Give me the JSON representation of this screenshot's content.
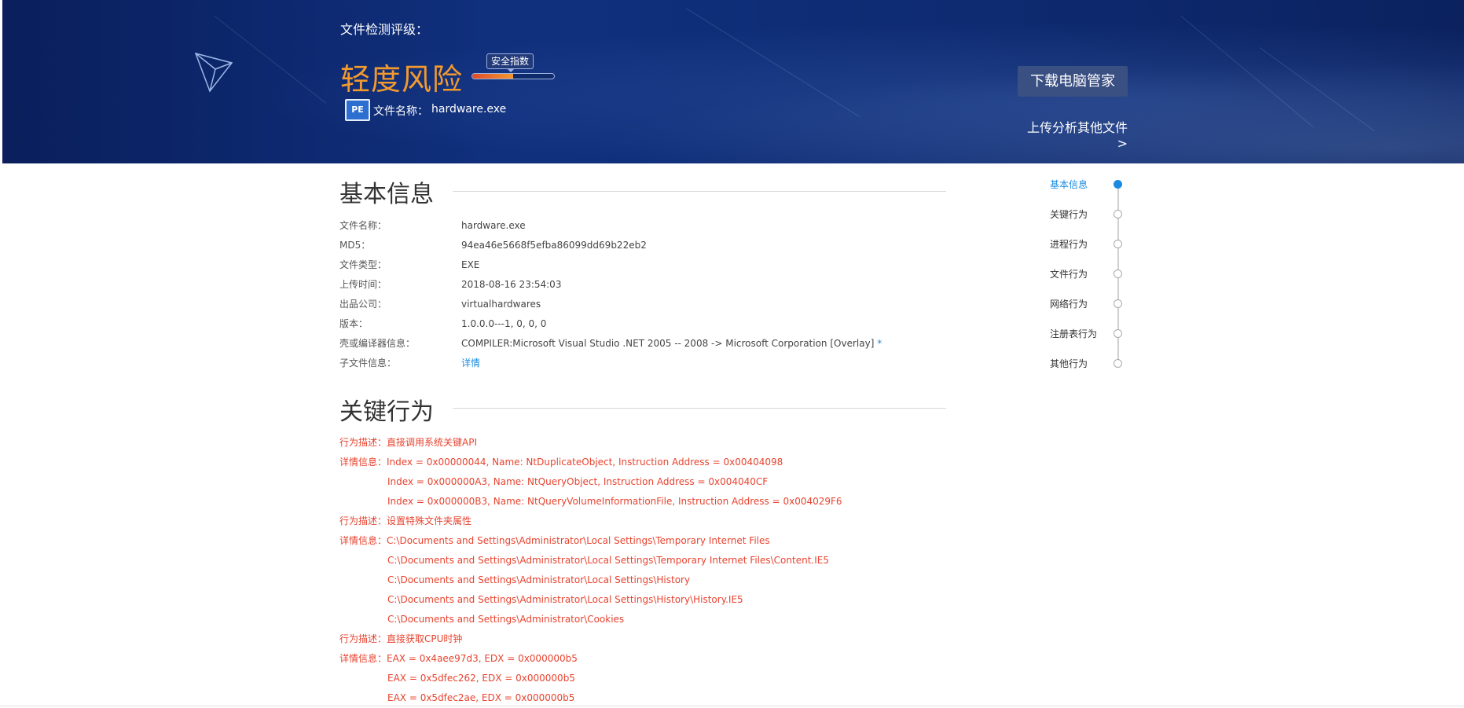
{
  "header": {
    "grade_label": "文件检测评级：",
    "risk_level": "轻度风险",
    "safety_index_label": "安全指数",
    "safety_index_level": 0.5,
    "file_icon_text": "PE",
    "file_name_label": "文件名称：",
    "file_name_value": "hardware.exe",
    "download_button": "下载电脑管家",
    "upload_link": "上传分析其他文件>"
  },
  "basic_info": {
    "title": "基本信息",
    "rows": [
      {
        "label": "文件名称：",
        "value": "hardware.exe"
      },
      {
        "label": "MD5：",
        "value": "94ea46e5668f5efba86099dd69b22eb2"
      },
      {
        "label": "文件类型：",
        "value": "EXE"
      },
      {
        "label": "上传时间：",
        "value": "2018-08-16 23:54:03"
      },
      {
        "label": "出品公司：",
        "value": "virtualhardwares"
      },
      {
        "label": "版本：",
        "value": "1.0.0.0---1, 0, 0, 0"
      },
      {
        "label": "壳或编译器信息：",
        "value": "COMPILER:Microsoft Visual Studio .NET 2005 -- 2008 -> Microsoft Corporation [Overlay]",
        "suffix": " *"
      },
      {
        "label": "子文件信息：",
        "value": "详情"
      }
    ]
  },
  "key_behavior": {
    "title": "关键行为",
    "lines": [
      "行为描述：直接调用系统关键API",
      "详情信息：Index = 0x00000044, Name: NtDuplicateObject, Instruction Address = 0x00404098",
      "Index = 0x000000A3, Name: NtQueryObject, Instruction Address = 0x004040CF",
      "Index = 0x000000B3, Name: NtQueryVolumeInformationFile, Instruction Address = 0x004029F6",
      "行为描述：设置特殊文件夹属性",
      "详情信息：C:\\Documents and Settings\\Administrator\\Local Settings\\Temporary Internet Files",
      "C:\\Documents and Settings\\Administrator\\Local Settings\\Temporary Internet Files\\Content.IE5",
      "C:\\Documents and Settings\\Administrator\\Local Settings\\History",
      "C:\\Documents and Settings\\Administrator\\Local Settings\\History\\History.IE5",
      "C:\\Documents and Settings\\Administrator\\Cookies",
      "行为描述：直接获取CPU时钟",
      "详情信息：EAX = 0x4aee97d3, EDX = 0x000000b5",
      "EAX = 0x5dfec262, EDX = 0x000000b5",
      "EAX = 0x5dfec2ae, EDX = 0x000000b5"
    ]
  },
  "side_nav": {
    "items": [
      "基本信息",
      "关键行为",
      "进程行为",
      "文件行为",
      "网络行为",
      "注册表行为",
      "其他行为"
    ],
    "active_index": 0
  },
  "colors": {
    "banner": "#0e2b72",
    "risk_orange": "#f39a2e",
    "behavior_red": "#e8432f",
    "link_blue": "#1a8be0"
  }
}
